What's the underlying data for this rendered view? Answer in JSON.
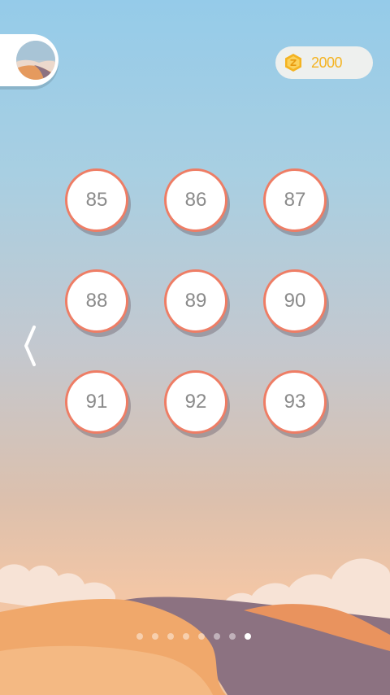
{
  "player": {
    "avatar_icon": "desert-landscape-avatar"
  },
  "currency": {
    "icon": "z-coin-icon",
    "amount": "2000",
    "color": "#f4b321"
  },
  "navigation": {
    "back_icon": "chevron-left-icon"
  },
  "levels": [
    "85",
    "86",
    "87",
    "88",
    "89",
    "90",
    "91",
    "92",
    "93"
  ],
  "pagination": {
    "total_pages": 8,
    "current_page": 8
  },
  "theme": {
    "ring_color": "#ee7d65",
    "number_color": "#8a8a8a"
  }
}
